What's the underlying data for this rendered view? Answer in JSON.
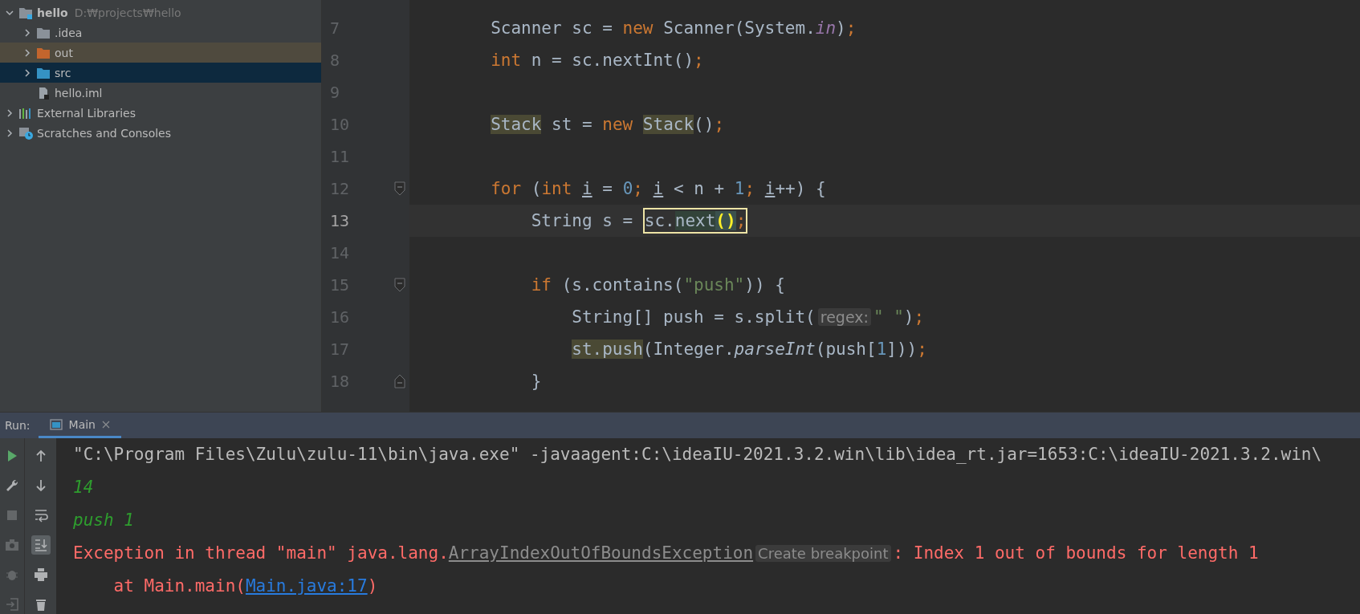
{
  "project_tree": {
    "items": [
      {
        "name": "hello",
        "path": "D:₩projects₩hello",
        "kind": "module",
        "expanded": true,
        "selected": false,
        "children": [
          {
            "name": ".idea",
            "kind": "folder",
            "expanded": false,
            "selected": false
          },
          {
            "name": "out",
            "kind": "excluded",
            "expanded": false,
            "selected": false
          },
          {
            "name": "src",
            "kind": "source",
            "expanded": false,
            "selected": true
          },
          {
            "name": "hello.iml",
            "kind": "file",
            "selected": false
          }
        ]
      },
      {
        "name": "External Libraries",
        "kind": "libraries",
        "expanded": false,
        "selected": false
      },
      {
        "name": "Scratches and Consoles",
        "kind": "scratches",
        "expanded": false,
        "selected": false
      }
    ]
  },
  "editor": {
    "lines": [
      {
        "number": "7",
        "current": false,
        "tokens": [
          {
            "text": "        Scanner sc = ",
            "kind": "plain"
          },
          {
            "text": "new",
            "kind": "keyword"
          },
          {
            "text": " Scanner(System.",
            "kind": "plain"
          },
          {
            "text": "in",
            "kind": "static"
          },
          {
            "text": ")",
            "kind": "plain"
          },
          {
            "text": ";",
            "kind": "keyword"
          }
        ]
      },
      {
        "number": "8",
        "current": false,
        "tokens": [
          {
            "text": "        int",
            "kind": "keyword"
          },
          {
            "text": " n = sc.nextInt()",
            "kind": "plain"
          },
          {
            "text": ";",
            "kind": "keyword"
          }
        ]
      },
      {
        "number": "9",
        "current": false
      },
      {
        "number": "10",
        "current": false,
        "tokens": [
          {
            "text": "        Stack",
            "kind": "usage"
          },
          {
            "text": " st = ",
            "kind": "plain"
          },
          {
            "text": "new ",
            "kind": "keyword"
          },
          {
            "text": "Stack",
            "kind": "usage"
          },
          {
            "text": "()",
            "kind": "plain"
          },
          {
            "text": ";",
            "kind": "keyword"
          }
        ]
      },
      {
        "number": "11",
        "current": false
      },
      {
        "number": "12",
        "current": false,
        "fold": {
          "kind": "start"
        },
        "tokens": [
          {
            "text": "        for",
            "kind": "keyword"
          },
          {
            "text": " (",
            "kind": "plain"
          },
          {
            "text": "int ",
            "kind": "keyword"
          },
          {
            "text": "i",
            "kind": "underline"
          },
          {
            "text": " = ",
            "kind": "plain"
          },
          {
            "text": "0",
            "kind": "number"
          },
          {
            "text": "; ",
            "kind": "keyword"
          },
          {
            "text": "i",
            "kind": "underline"
          },
          {
            "text": " < n + ",
            "kind": "plain"
          },
          {
            "text": "1",
            "kind": "number"
          },
          {
            "text": "; ",
            "kind": "keyword"
          },
          {
            "text": "i",
            "kind": "underline"
          },
          {
            "text": "++) {",
            "kind": "plain"
          }
        ]
      },
      {
        "number": "13",
        "current": true,
        "tokens": [
          {
            "text": "            String s = ",
            "kind": "plain"
          }
        ],
        "boxed": [
          {
            "text": "sc.",
            "kind": "plain"
          },
          {
            "text": "next",
            "kind": "search"
          },
          {
            "text": "()",
            "kind": "match"
          },
          {
            "text": ";",
            "kind": "keyword"
          }
        ]
      },
      {
        "number": "14",
        "current": false
      },
      {
        "number": "15",
        "current": false,
        "fold": {
          "kind": "start"
        },
        "tokens": [
          {
            "text": "            if",
            "kind": "keyword"
          },
          {
            "text": " (s.contains(",
            "kind": "plain"
          },
          {
            "text": "\"push\"",
            "kind": "string"
          },
          {
            "text": ")) {",
            "kind": "plain"
          }
        ]
      },
      {
        "number": "16",
        "current": false,
        "tokens": [
          {
            "text": "                String[] push = s.split(",
            "kind": "plain"
          },
          {
            "text": "regex:",
            "kind": "hint"
          },
          {
            "text": "\" \"",
            "kind": "string"
          },
          {
            "text": ")",
            "kind": "plain"
          },
          {
            "text": ";",
            "kind": "keyword"
          }
        ]
      },
      {
        "number": "17",
        "current": false,
        "tokens": [
          {
            "text": "                st.push",
            "kind": "usage"
          },
          {
            "text": "(Integer.",
            "kind": "plain"
          },
          {
            "text": "parseInt",
            "kind": "italic"
          },
          {
            "text": "(push[",
            "kind": "plain"
          },
          {
            "text": "1",
            "kind": "number"
          },
          {
            "text": "]))",
            "kind": "plain"
          },
          {
            "text": ";",
            "kind": "keyword"
          }
        ]
      },
      {
        "number": "18",
        "current": false,
        "fold": {
          "kind": "end"
        },
        "tokens": [
          {
            "text": "            }",
            "kind": "plain"
          }
        ]
      }
    ]
  },
  "run_panel": {
    "label": "Run:",
    "tabs": [
      {
        "title": "Main",
        "selected": true
      }
    ],
    "toolbar_left": [
      {
        "kind": "run",
        "disabled": false
      },
      {
        "kind": "settings",
        "disabled": false
      },
      {
        "kind": "stop",
        "disabled": true
      },
      {
        "kind": "camera",
        "disabled": true
      },
      {
        "kind": "debug",
        "disabled": true
      },
      {
        "kind": "exit",
        "disabled": true
      }
    ],
    "toolbar_right": [
      {
        "kind": "up",
        "on": false
      },
      {
        "kind": "down",
        "on": false
      },
      {
        "kind": "wrap",
        "on": false
      },
      {
        "kind": "scroll-end",
        "on": true
      },
      {
        "kind": "print",
        "on": false
      },
      {
        "kind": "delete",
        "on": false
      }
    ],
    "console": [
      [
        {
          "text": "\"C:\\Program Files\\Zulu\\zulu-11\\bin\\java.exe\" -javaagent:C:\\ideaIU-2021.3.2.win\\lib\\idea_rt.jar=1653:C:\\ideaIU-2021.3.2.win\\",
          "kind": "plain"
        }
      ],
      [
        {
          "text": "14",
          "kind": "input"
        }
      ],
      [
        {
          "text": "push 1",
          "kind": "input"
        }
      ],
      [
        {
          "text": "Exception in thread \"main\" java.lang.",
          "kind": "error"
        },
        {
          "text": "ArrayIndexOutOfBoundsException",
          "kind": "class-link"
        },
        {
          "text": "Create breakpoint",
          "kind": "hint"
        },
        {
          "text": ": Index 1 out of bounds for length 1",
          "kind": "error"
        }
      ],
      [
        {
          "text": "    at Main.main(",
          "kind": "error"
        },
        {
          "text": "Main.java:17",
          "kind": "file-link"
        },
        {
          "text": ")",
          "kind": "error"
        }
      ]
    ]
  }
}
